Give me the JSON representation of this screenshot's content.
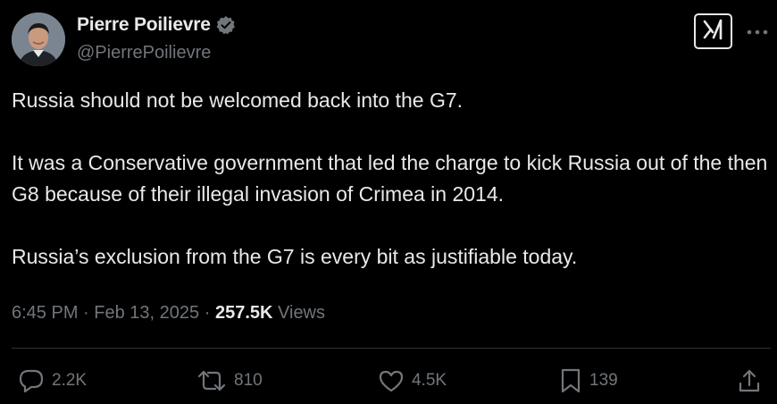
{
  "author": {
    "display_name": "Pierre Poilievre",
    "handle": "@PierrePoilievre",
    "verified": true,
    "verified_color": "#71767b"
  },
  "header_actions": {
    "grok_icon": "grok-icon",
    "more_icon": "more-icon"
  },
  "tweet": {
    "paragraphs": [
      "Russia should not be welcomed back into the G7.",
      "It was a Conservative government that led the charge to kick Russia out of the then G8 because of their illegal invasion of Crimea in 2014.",
      "Russia’s exclusion from the G7 is every bit as justifiable today."
    ]
  },
  "meta": {
    "time": "6:45 PM",
    "separator": "·",
    "date": "Feb 13, 2025",
    "views_count": "257.5K",
    "views_label": "Views"
  },
  "actions": {
    "replies": "2.2K",
    "reposts": "810",
    "likes": "4.5K",
    "bookmarks": "139"
  },
  "colors": {
    "background": "#000000",
    "text": "#e7e9ea",
    "muted": "#71767b",
    "divider": "#2f3336"
  }
}
